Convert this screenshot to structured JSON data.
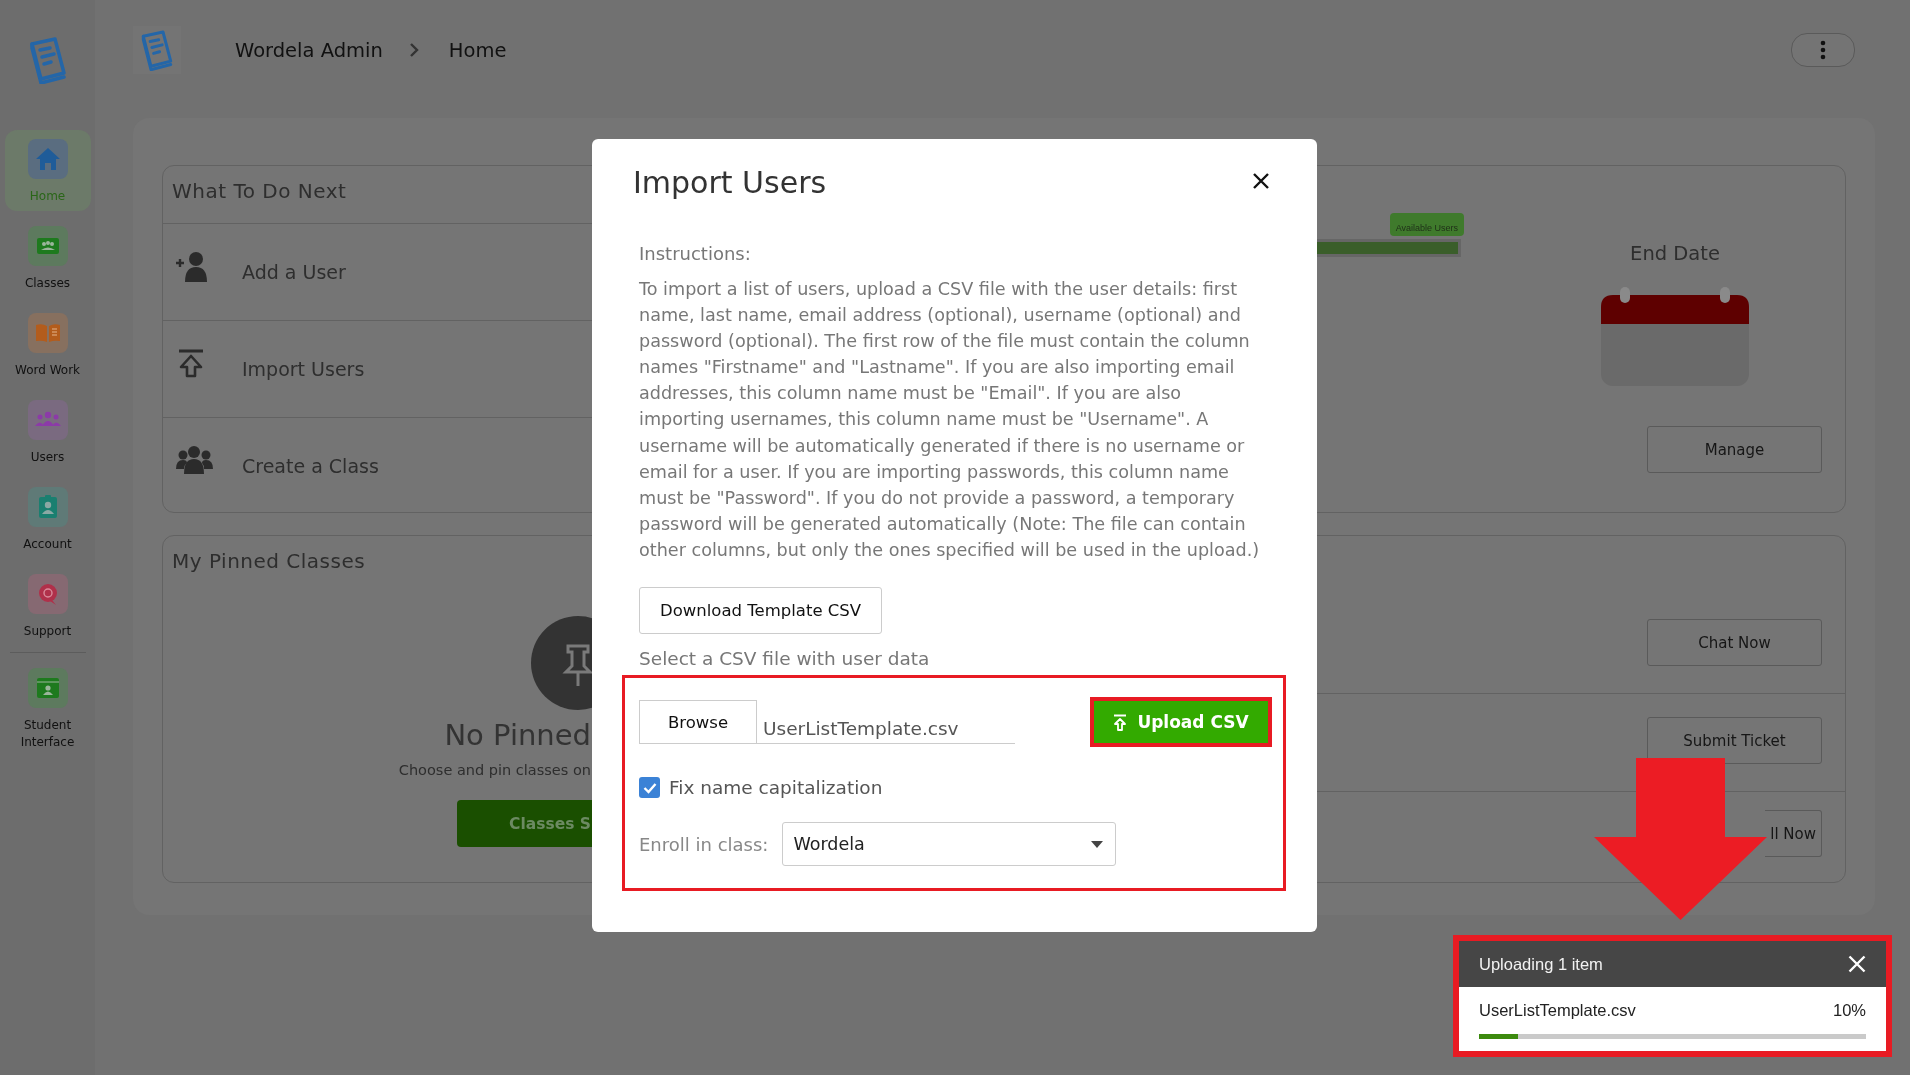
{
  "sidebar": {
    "items": [
      {
        "kind": "home",
        "label": "Home",
        "selected": true
      },
      {
        "kind": "classes",
        "label": "Classes",
        "selected": false
      },
      {
        "kind": "book",
        "label": "Word Work",
        "selected": false
      },
      {
        "kind": "users",
        "label": "Users",
        "selected": false
      },
      {
        "kind": "account",
        "label": "Account",
        "selected": false
      },
      {
        "kind": "support",
        "label": "Support",
        "selected": false
      },
      {
        "kind": "student",
        "label": "Student Interface",
        "selected": false
      }
    ]
  },
  "header": {
    "breadcrumb": [
      "Wordela Admin",
      "Home"
    ]
  },
  "what_to_do_next": {
    "title": "What To Do Next",
    "actions": [
      {
        "kind": "add-user",
        "label": "Add a User"
      },
      {
        "kind": "import",
        "label": "Import Users"
      },
      {
        "kind": "group",
        "label": "Create a Class"
      }
    ],
    "chart_tooltip": "Available Users",
    "end_date_label": "End Date",
    "manage_button": "Manage"
  },
  "pinned_classes": {
    "title": "My Pinned Classes",
    "empty_title": "No Pinned",
    "empty_text": "Choose and pin classes on",
    "button": "Classes S"
  },
  "support": {
    "buttons": [
      "Chat Now",
      "Submit Ticket",
      "ll Now"
    ]
  },
  "import_dialog": {
    "title": "Import Users",
    "instructions_label": "Instructions:",
    "instructions": "To import a list of users, upload a CSV file with the user details: first name, last name, email address (optional), username (optional) and password (optional). The first row of the file must contain the column names \"Firstname\" and \"Lastname\". If you are also importing email addresses, this column name must be \"Email\". If you are also importing usernames, this column name must be \"Username\". A username will be automatically generated if there is no username or email for a user. If you are importing passwords, this column name must be \"Password\". If you do not provide a password, a temporary password will be generated automatically (Note: The file can contain other columns, but only the ones specified will be used in the upload.)",
    "download_button": "Download Template CSV",
    "file_label": "Select a CSV file with user data",
    "browse_button": "Browse",
    "file_name": "UserListTemplate.csv",
    "upload_button": "Upload CSV",
    "fix_capitalization": {
      "label": "Fix name capitalization",
      "checked": true
    },
    "enroll": {
      "label": "Enroll in class:",
      "value": "Wordela"
    }
  },
  "upload_toast": {
    "title": "Uploading 1 item",
    "file_name": "UserListTemplate.csv",
    "percent": "10%",
    "level": 0.1
  }
}
